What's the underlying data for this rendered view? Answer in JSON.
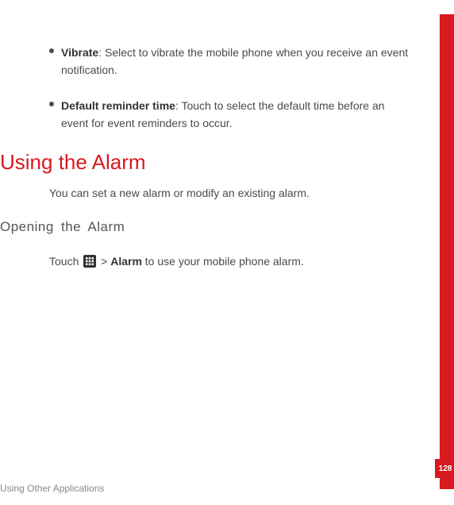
{
  "bullets": [
    {
      "term": "Vibrate",
      "desc": ": Select to vibrate the mobile phone when you receive an event notification."
    },
    {
      "term": "Default reminder time",
      "desc": ": Touch to select the default time before an event for event reminders to occur."
    }
  ],
  "section": {
    "heading": "Using the Alarm",
    "intro": "You can set a new alarm or modify an existing alarm."
  },
  "subsection": {
    "heading": "Opening the Alarm",
    "touch_prefix": "Touch ",
    "touch_mid": " > ",
    "touch_app": "Alarm",
    "touch_suffix": " to use your mobile phone alarm."
  },
  "footer": {
    "text": "Using Other Applications"
  },
  "page_number": "128"
}
